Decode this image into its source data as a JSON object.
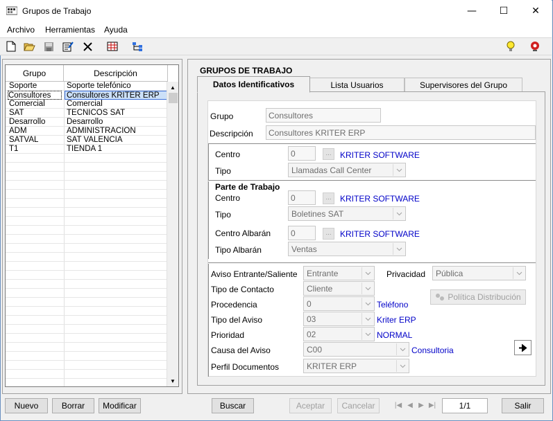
{
  "window": {
    "title": "Grupos de Trabajo"
  },
  "menu": {
    "items": [
      "Archivo",
      "Herramientas",
      "Ayuda"
    ]
  },
  "grid": {
    "headers": [
      "Grupo",
      "Descripción"
    ],
    "rows": [
      [
        "Soporte",
        "Soporte telefónico"
      ],
      [
        "Consultores",
        "Consultores KRITER ERP"
      ],
      [
        "Comercial",
        "Comercial"
      ],
      [
        "SAT",
        "TECNICOS SAT"
      ],
      [
        "Desarrollo",
        "Desarrollo"
      ],
      [
        "ADM",
        "ADMINISTRACION"
      ],
      [
        "SATVAL",
        "SAT VALENCIA"
      ],
      [
        "T1",
        "TIENDA 1"
      ]
    ],
    "selected_index": 1
  },
  "panel": {
    "title": "GRUPOS DE TRABAJO",
    "tabs": [
      "Datos Identificativos",
      "Lista Usuarios",
      "Supervisores del Grupo"
    ]
  },
  "form": {
    "grupo_label": "Grupo",
    "grupo_value": "Consultores",
    "descripcion_label": "Descripción",
    "descripcion_value": "Consultores KRITER ERP",
    "centro_label": "Centro",
    "centro_value": "0",
    "centro_link": "KRITER SOFTWARE",
    "tipo_label": "Tipo",
    "tipo_value": "Llamadas Call Center",
    "parte_title": "Parte de Trabajo",
    "pt_centro_label": "Centro",
    "pt_centro_value": "0",
    "pt_centro_link": "KRITER SOFTWARE",
    "pt_tipo_label": "Tipo",
    "pt_tipo_value": "Boletines SAT",
    "centro_alb_label": "Centro Albarán",
    "centro_alb_value": "0",
    "centro_alb_link": "KRITER SOFTWARE",
    "tipo_alb_label": "Tipo Albarán",
    "tipo_alb_value": "Ventas",
    "dots": "...",
    "aviso_label": "Aviso Entrante/Saliente",
    "aviso_value": "Entrante",
    "privacidad_label": "Privacidad",
    "privacidad_value": "Pública",
    "contacto_label": "Tipo de Contacto",
    "contacto_value": "Cliente",
    "politica_button": "Política Distribución",
    "procedencia_label": "Procedencia",
    "procedencia_value": "0",
    "procedencia_link": "Teléfono",
    "tipo_aviso_label": "Tipo del Aviso",
    "tipo_aviso_value": "03",
    "tipo_aviso_link": "Kriter ERP",
    "prioridad_label": "Prioridad",
    "prioridad_value": "02",
    "prioridad_link": "NORMAL",
    "causa_label": "Causa del Aviso",
    "causa_value": "C00",
    "causa_link": "Consultoria",
    "perfil_label": "Perfil Documentos",
    "perfil_value": "KRITER ERP"
  },
  "buttons": {
    "nuevo": "Nuevo",
    "borrar": "Borrar",
    "modificar": "Modificar",
    "buscar": "Buscar",
    "aceptar": "Aceptar",
    "cancelar": "Cancelar",
    "pager": "1/1",
    "salir": "Salir"
  },
  "colors": {
    "link": "#0000c8",
    "selection_border": "#3c6fd8"
  }
}
